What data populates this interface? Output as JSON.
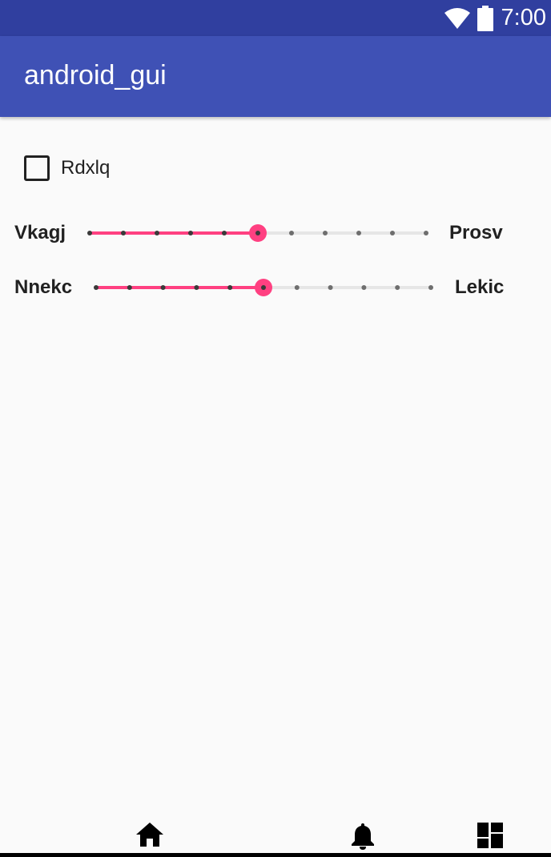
{
  "status_bar": {
    "time": "7:00",
    "icons": [
      "wifi-icon",
      "battery-icon"
    ]
  },
  "app_bar": {
    "title": "android_gui"
  },
  "checkbox": {
    "label": "Rdxlq",
    "checked": false
  },
  "sliders": [
    {
      "left_label": "Vkagj",
      "right_label": "Prosv",
      "steps": 10,
      "value": 5
    },
    {
      "left_label": "Nnekc",
      "right_label": "Lekic",
      "steps": 10,
      "value": 5
    }
  ],
  "colors": {
    "status_bar": "#303f9f",
    "app_bar": "#3f51b5",
    "accent": "#ff4081",
    "background": "#fafafa"
  },
  "bottom_nav": {
    "icons": [
      "home-icon",
      "bell-icon",
      "dashboard-icon"
    ]
  }
}
